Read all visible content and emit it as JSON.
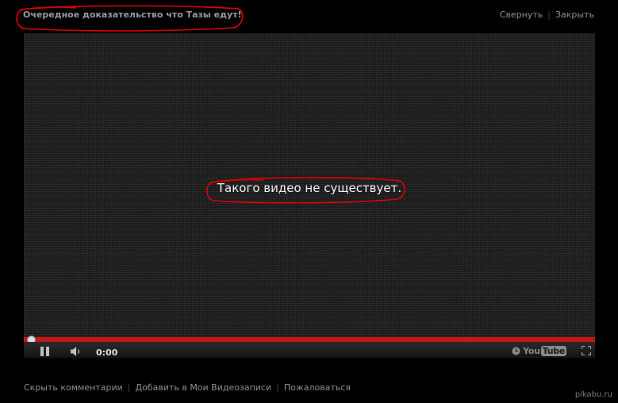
{
  "window": {
    "title": "Очередное доказательство что Тазы едут!",
    "minimize_label": "Свернуть",
    "close_label": "Закрыть"
  },
  "player": {
    "message": "Такого видео не существует.",
    "current_time": "0:00",
    "progress": 0,
    "logo_part1": "You",
    "logo_part2": "Tube",
    "accent_color": "#c4161c"
  },
  "footer": {
    "links": [
      "Скрыть комментарии",
      "Добавить в Мои Видеозаписи",
      "Пожаловаться"
    ]
  },
  "watermark": "pikabu.ru",
  "annotation_color": "#e00000",
  "icons": [
    "pause-icon",
    "volume-icon",
    "clock-icon",
    "youtube-logo",
    "fullscreen-icon"
  ]
}
